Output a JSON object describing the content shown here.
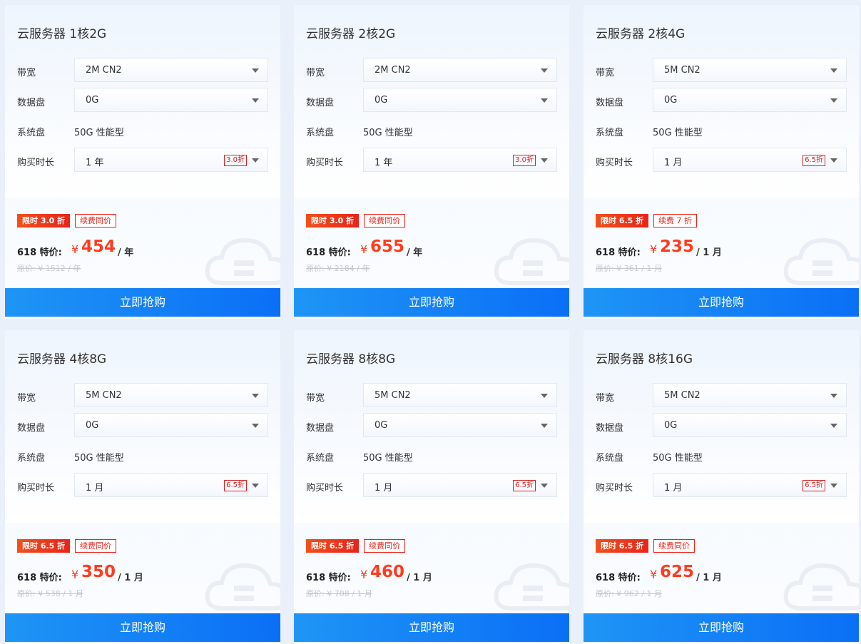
{
  "labels": {
    "bandwidth": "带宽",
    "data_disk": "数据盘",
    "system_disk": "系统盘",
    "duration": "购买时长",
    "price_prefix": "618 特价:",
    "currency": "¥",
    "buy_button": "立即抢购"
  },
  "colors": {
    "accent_red": "#ff3b1f",
    "button_blue": "#0a6ff6"
  },
  "cards": [
    {
      "title": "云服务器 1核2G",
      "bandwidth": "2M CN2",
      "data_disk": "0G",
      "system_disk": "50G 性能型",
      "duration": "1 年",
      "duration_discount": "3.0折",
      "badge_promo": "限时 3.0 折",
      "badge_renew": "续费同价",
      "price": "454",
      "unit": "/ 年",
      "original": "原价: ¥ 1512 / 年"
    },
    {
      "title": "云服务器 2核2G",
      "bandwidth": "2M CN2",
      "data_disk": "0G",
      "system_disk": "50G 性能型",
      "duration": "1 年",
      "duration_discount": "3.0折",
      "badge_promo": "限时 3.0 折",
      "badge_renew": "续费同价",
      "price": "655",
      "unit": "/ 年",
      "original": "原价: ¥ 2184 / 年"
    },
    {
      "title": "云服务器 2核4G",
      "bandwidth": "5M CN2",
      "data_disk": "0G",
      "system_disk": "50G 性能型",
      "duration": "1 月",
      "duration_discount": "6.5折",
      "badge_promo": "限时 6.5 折",
      "badge_renew": "续费 7 折",
      "price": "235",
      "unit": "/ 1 月",
      "original": "原价: ¥ 361 / 1 月"
    },
    {
      "title": "云服务器 4核8G",
      "bandwidth": "5M CN2",
      "data_disk": "0G",
      "system_disk": "50G 性能型",
      "duration": "1 月",
      "duration_discount": "6.5折",
      "badge_promo": "限时 6.5 折",
      "badge_renew": "续费同价",
      "price": "350",
      "unit": "/ 1 月",
      "original": "原价: ¥ 538 / 1 月"
    },
    {
      "title": "云服务器 8核8G",
      "bandwidth": "5M CN2",
      "data_disk": "0G",
      "system_disk": "50G 性能型",
      "duration": "1 月",
      "duration_discount": "6.5折",
      "badge_promo": "限时 6.5 折",
      "badge_renew": "续费同价",
      "price": "460",
      "unit": "/ 1 月",
      "original": "原价: ¥ 708 / 1 月"
    },
    {
      "title": "云服务器 8核16G",
      "bandwidth": "5M CN2",
      "data_disk": "0G",
      "system_disk": "50G 性能型",
      "duration": "1 月",
      "duration_discount": "6.5折",
      "badge_promo": "限时 6.5 折",
      "badge_renew": "续费同价",
      "price": "625",
      "unit": "/ 1 月",
      "original": "原价: ¥ 962 / 1 月"
    }
  ]
}
